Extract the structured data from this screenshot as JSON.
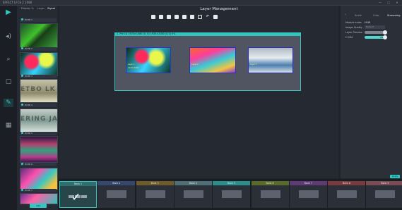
{
  "window": {
    "title": "EFFECT LFCE 2 1080",
    "controls": [
      "—",
      "☐",
      "✕"
    ]
  },
  "rail": {
    "icons": [
      "play-icon",
      "volume-icon",
      "search-icon",
      "monitor-icon",
      "edit-icon",
      "grid-icon"
    ]
  },
  "source_panel": {
    "tabs": [
      "Display %",
      "Layer",
      "Signal"
    ],
    "items": [
      {
        "label": "HDMI 1"
      },
      {
        "label": "HDMI 2"
      },
      {
        "label": "HDMI 3"
      },
      {
        "label": "HDMI 4"
      },
      {
        "label": "HDMI 5"
      },
      {
        "label": "HDMI 6"
      },
      {
        "label": "HDMI 7"
      }
    ],
    "thumb_texts": [
      "",
      "",
      "ETBO LK AL",
      "ERING JAS RM",
      "",
      "",
      ""
    ],
    "add_button": "Add"
  },
  "main": {
    "title": "Layer Management",
    "canvas_header": "1. Pre 1A 1920×1080 (0, 0) 1920×1080 (0,0) 0%",
    "layers": [
      {
        "label": "Layer 1",
        "caption": "1920×1080"
      },
      {
        "label": "Layer 2",
        "caption": ""
      },
      {
        "label": "Layer 3",
        "caption": ""
      }
    ]
  },
  "properties": {
    "tabs": [
      "‹",
      "Scale",
      "Crop",
      "Streaming"
    ],
    "rows": [
      {
        "label": "Module Index",
        "value": "HVW"
      },
      {
        "label": "Image Quality",
        "value": "Default"
      },
      {
        "label": "Layer Preview",
        "value": ""
      },
      {
        "label": "H 264",
        "value": "ON"
      }
    ],
    "apply": "Apply"
  },
  "scenes": [
    {
      "label": "Bank 1",
      "color": "#2f6f6f",
      "selected": true
    },
    {
      "label": "Bank 2",
      "color": "#35466f",
      "selected": false
    },
    {
      "label": "Bank 3",
      "color": "#6f5a2a",
      "selected": false
    },
    {
      "label": "Bank 4",
      "color": "#4f6f76",
      "selected": false
    },
    {
      "label": "Bank 5",
      "color": "#2a8e8a",
      "selected": false
    },
    {
      "label": "Bank 6",
      "color": "#5a6a2a",
      "selected": false
    },
    {
      "label": "Bank 7",
      "color": "#5f3a77",
      "selected": false
    },
    {
      "label": "Bank 8",
      "color": "#7a3b3f",
      "selected": false
    },
    {
      "label": "Bank 9",
      "color": "#7a4b53",
      "selected": false
    }
  ],
  "colors": {
    "accent": "#32c4bf",
    "layer_border": "#2b37c9"
  }
}
